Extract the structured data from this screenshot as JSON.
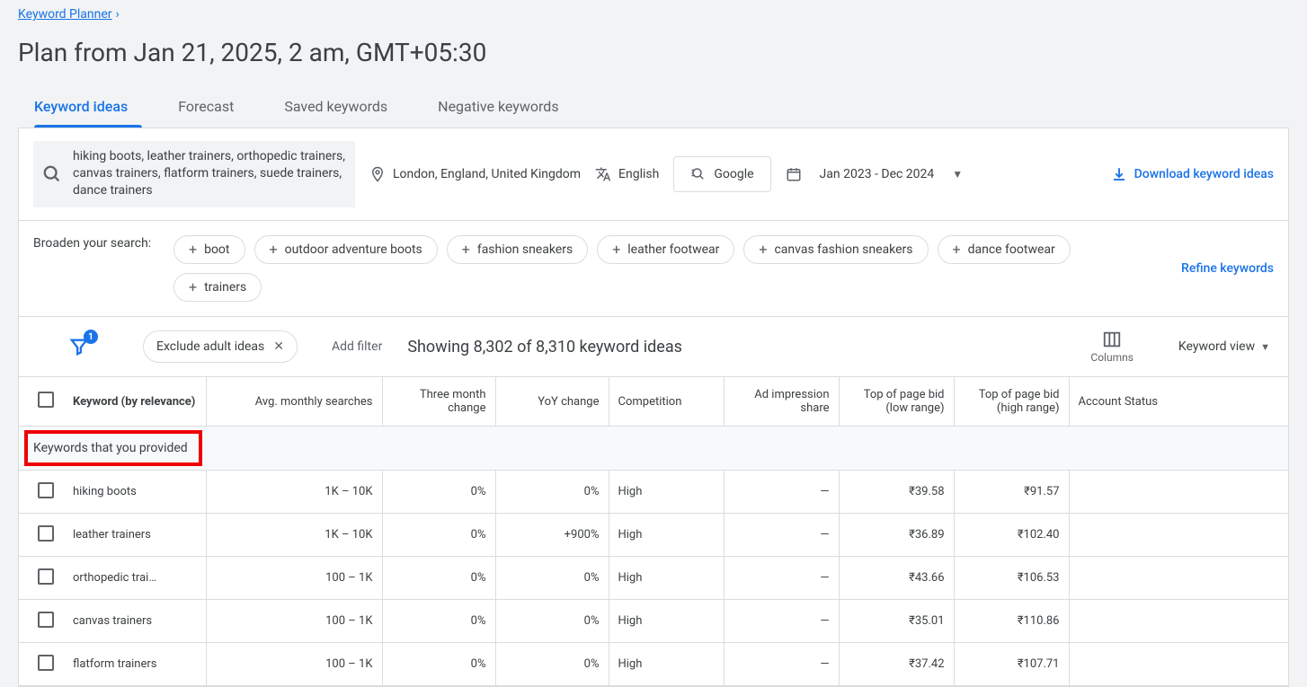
{
  "breadcrumb": {
    "label": "Keyword Planner"
  },
  "page_title": "Plan from Jan 21, 2025, 2 am, GMT+05:30",
  "tabs": [
    {
      "label": "Keyword ideas",
      "active": true
    },
    {
      "label": "Forecast",
      "active": false
    },
    {
      "label": "Saved keywords",
      "active": false
    },
    {
      "label": "Negative keywords",
      "active": false
    }
  ],
  "filters": {
    "search_text": "hiking boots, leather trainers, orthopedic trainers, canvas trainers, flatform trainers, suede trainers, dance trainers",
    "location": "London, England, United Kingdom",
    "language": "English",
    "network": "Google",
    "date_range": "Jan 2023 - Dec 2024",
    "download_label": "Download keyword ideas"
  },
  "broaden": {
    "label": "Broaden your search:",
    "chips": [
      "boot",
      "outdoor adventure boots",
      "fashion sneakers",
      "leather footwear",
      "canvas fashion sneakers",
      "dance footwear",
      "trainers"
    ],
    "refine_label": "Refine keywords"
  },
  "results_bar": {
    "funnel_badge": "1",
    "exclude_chip": "Exclude adult ideas",
    "add_filter": "Add filter",
    "count_text": "Showing 8,302 of 8,310 keyword ideas",
    "columns_label": "Columns",
    "view_label": "Keyword view"
  },
  "table": {
    "headers": {
      "keyword": "Keyword (by relevance)",
      "searches": "Avg. monthly searches",
      "three_month": "Three month change",
      "yoy": "YoY change",
      "competition": "Competition",
      "impression": "Ad impression share",
      "low_bid": "Top of page bid (low range)",
      "high_bid": "Top of page bid (high range)",
      "status": "Account Status"
    },
    "section_label": "Keywords that you provided",
    "rows": [
      {
        "keyword": "hiking boots",
        "searches": "1K – 10K",
        "three_month": "0%",
        "yoy": "0%",
        "competition": "High",
        "impression": "—",
        "low_bid": "₹39.58",
        "high_bid": "₹91.57",
        "status": ""
      },
      {
        "keyword": "leather trainers",
        "searches": "1K – 10K",
        "three_month": "0%",
        "yoy": "+900%",
        "competition": "High",
        "impression": "—",
        "low_bid": "₹36.89",
        "high_bid": "₹102.40",
        "status": ""
      },
      {
        "keyword": "orthopedic trai…",
        "searches": "100 – 1K",
        "three_month": "0%",
        "yoy": "0%",
        "competition": "High",
        "impression": "—",
        "low_bid": "₹43.66",
        "high_bid": "₹106.53",
        "status": ""
      },
      {
        "keyword": "canvas trainers",
        "searches": "100 – 1K",
        "three_month": "0%",
        "yoy": "0%",
        "competition": "High",
        "impression": "—",
        "low_bid": "₹35.01",
        "high_bid": "₹110.86",
        "status": ""
      },
      {
        "keyword": "flatform trainers",
        "searches": "100 – 1K",
        "three_month": "0%",
        "yoy": "0%",
        "competition": "High",
        "impression": "—",
        "low_bid": "₹37.42",
        "high_bid": "₹107.71",
        "status": ""
      }
    ]
  }
}
